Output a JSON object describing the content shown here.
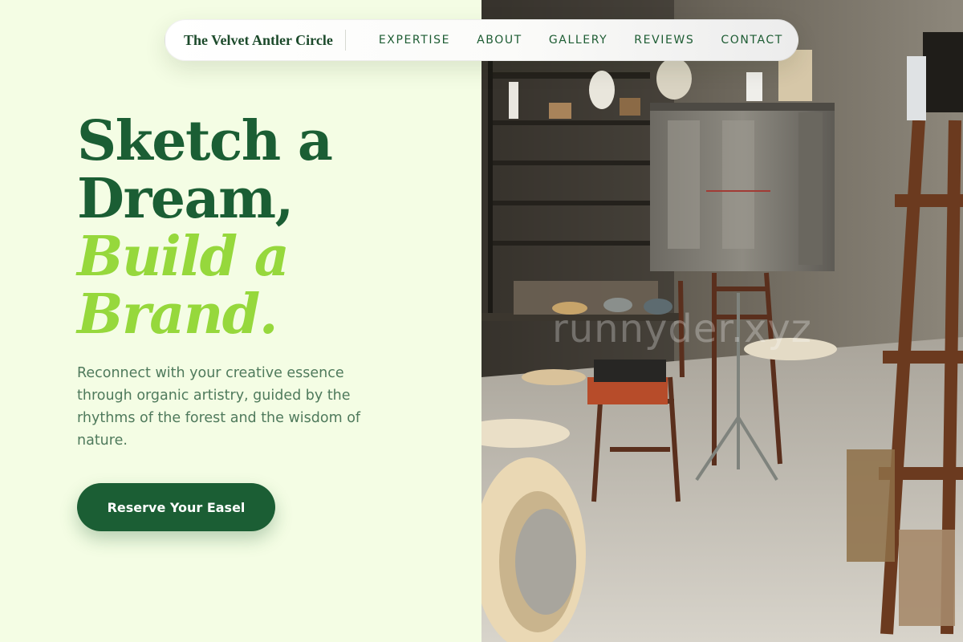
{
  "site": {
    "brand": "The Velvet Antler Circle"
  },
  "nav": {
    "items": [
      {
        "label": "EXPERTISE"
      },
      {
        "label": "ABOUT"
      },
      {
        "label": "GALLERY"
      },
      {
        "label": "REVIEWS"
      },
      {
        "label": "CONTACT"
      }
    ]
  },
  "hero": {
    "headline": {
      "line1": "Sketch a",
      "line2": "Dream,",
      "line3": "Build a",
      "line4": "Brand."
    },
    "lead": "Reconnect with your creative essence through organic artistry, guided by the rhythms of the forest and the wisdom of nature.",
    "cta_label": "Reserve Your Easel"
  },
  "photo": {
    "watermark": "runnyder.xyz"
  },
  "colors": {
    "background": "#f4fde4",
    "primary_green": "#1b5e34",
    "accent_lime": "#96d83c",
    "body_text": "#4f7a5c"
  }
}
